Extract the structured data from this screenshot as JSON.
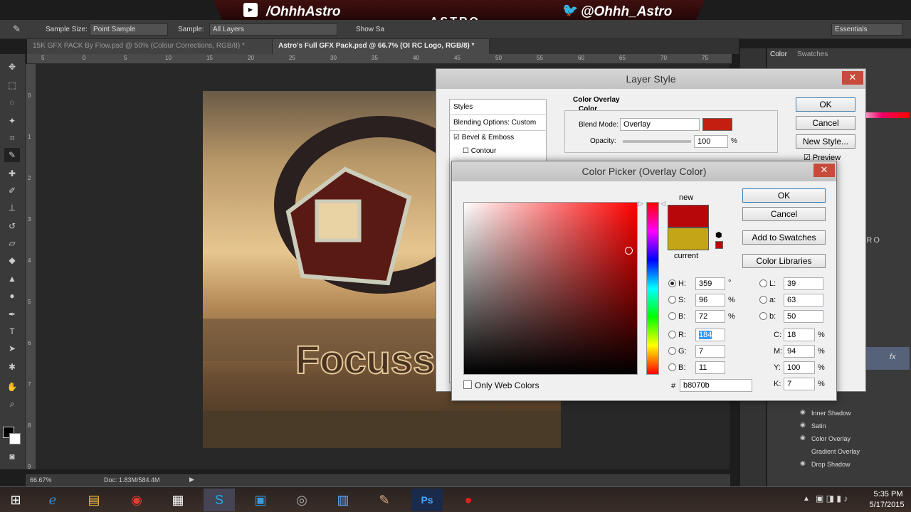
{
  "banner": {
    "youtube": "/OhhhAstro",
    "center": "Astro",
    "twitter": "@Ohhh_Astro"
  },
  "options": {
    "sample_size_label": "Sample Size:",
    "sample_size_value": "Point Sample",
    "sample_label": "Sample:",
    "sample_value": "All Layers",
    "show_sampling": "Show Sa",
    "workspace": "Essentials"
  },
  "tabs": [
    {
      "label": "15K GFX PACK By Flow.psd @ 50% (Colour Corrections, RGB/8) *"
    },
    {
      "label": "Astro's Full GFX Pack.psd @ 66.7% (OI RC Logo, RGB/8) *"
    }
  ],
  "ruler": {
    "top": [
      "5",
      "0",
      "5",
      "10",
      "15",
      "20",
      "25",
      "30",
      "35",
      "40",
      "45",
      "50",
      "55",
      "60",
      "65",
      "70",
      "75"
    ],
    "left": [
      "0",
      "1",
      "2",
      "3",
      "4",
      "5",
      "6",
      "7",
      "8",
      "9"
    ]
  },
  "artwork": {
    "text": "Focuss"
  },
  "status": {
    "zoom": "66.67%",
    "doc": "Doc: 1.83M/584.4M"
  },
  "right_panel": {
    "tabs": [
      "Color",
      "Swatches"
    ],
    "watermark": "Astro",
    "effects": [
      "Inner Shadow",
      "Satin",
      "Color Overlay",
      "Gradient Overlay",
      "Drop Shadow"
    ]
  },
  "layer_style": {
    "title": "Layer Style",
    "styles_header": "Styles",
    "blending": "Blending Options: Custom",
    "bevel": "Bevel & Emboss",
    "contour": "Contour",
    "section": "Color Overlay",
    "subsection": "Color",
    "blend_mode_label": "Blend Mode:",
    "blend_mode": "Overlay",
    "opacity_label": "Opacity:",
    "opacity": "100",
    "opacity_unit": "%",
    "ok": "OK",
    "cancel": "Cancel",
    "new_style": "New Style...",
    "preview": "Preview",
    "overlay_color": "#c41e10"
  },
  "color_picker": {
    "title": "Color Picker (Overlay Color)",
    "new_label": "new",
    "current_label": "current",
    "new_color": "#b8070b",
    "current_color": "#c4a516",
    "ok": "OK",
    "cancel": "Cancel",
    "add_swatches": "Add to Swatches",
    "libraries": "Color Libraries",
    "only_web": "Only Web Colors",
    "h_label": "H:",
    "h": "359",
    "h_unit": "°",
    "s_label": "S:",
    "s": "96",
    "s_unit": "%",
    "b_label": "B:",
    "b": "72",
    "b_unit": "%",
    "r_label": "R:",
    "r": "184",
    "g_label": "G:",
    "g": "7",
    "bl_label": "B:",
    "bl": "11",
    "l_label": "L:",
    "l": "39",
    "a_label": "a:",
    "a": "63",
    "b2_label": "b:",
    "b2": "50",
    "c_label": "C:",
    "c": "18",
    "c_unit": "%",
    "m_label": "M:",
    "m": "94",
    "m_unit": "%",
    "y_label": "Y:",
    "y": "100",
    "y_unit": "%",
    "k_label": "K:",
    "k": "7",
    "k_unit": "%",
    "hex_label": "#",
    "hex": "b8070b"
  },
  "taskbar": {
    "time": "5:35 PM",
    "date": "5/17/2015"
  }
}
